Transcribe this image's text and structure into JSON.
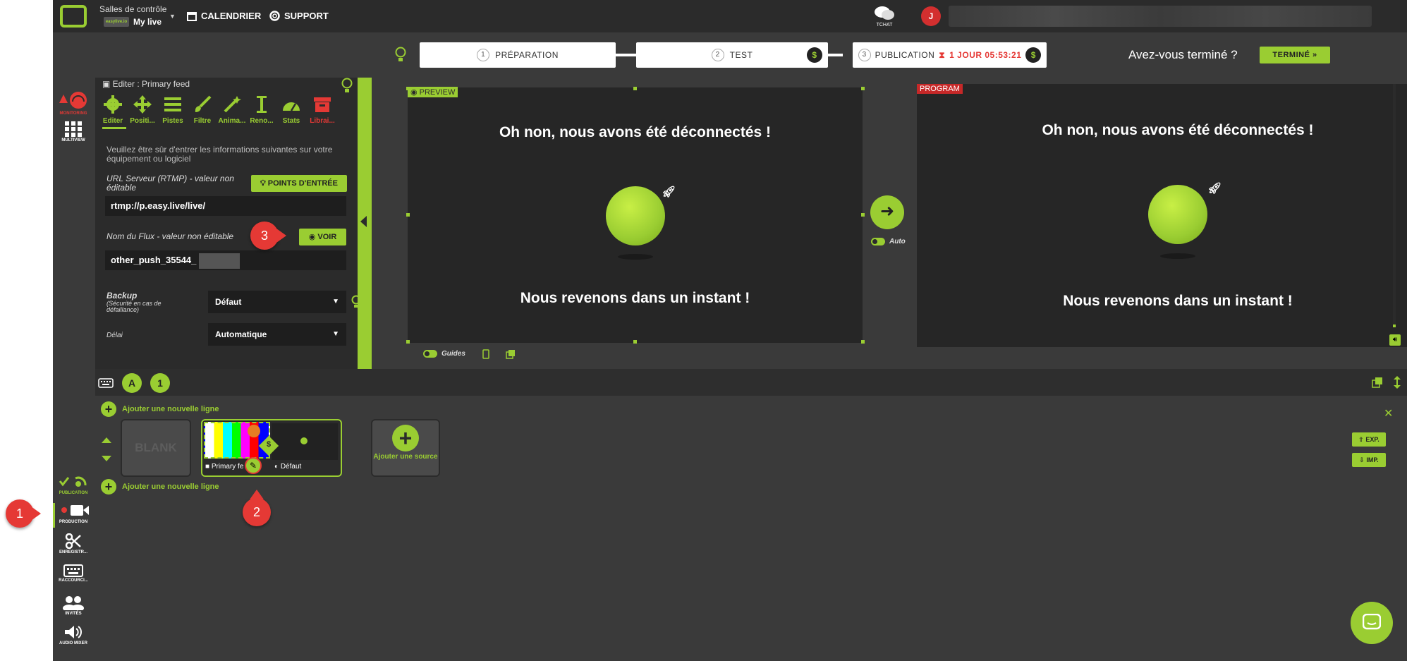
{
  "topbar": {
    "salles": "Salles de contrôle",
    "mylive": "My live",
    "mini_logo": "easylive.io",
    "calendrier": "CALENDRIER",
    "support": "SUPPORT",
    "chat": "TCHAT",
    "avatar": "J"
  },
  "steps": {
    "s1_num": "1",
    "s1_label": "PRÉPARATION",
    "s2_num": "2",
    "s2_label": "TEST",
    "s3_num": "3",
    "s3_label": "PUBLICATION",
    "countdown": "1 JOUR 05:53:21",
    "dollar": "$",
    "question": "Avez-vous terminé ?",
    "termine": "TERMINÉ"
  },
  "rail": {
    "multiview": "MULTIVIEW",
    "monitoring": "MONITORING",
    "publication": "PUBLICATION",
    "production": "PRODUCTION",
    "enregistrement": "ENREGISTR...",
    "raccourcis": "RACCOURCI...",
    "invites": "INVITÉS",
    "audio": "AUDIO MIXER"
  },
  "editor": {
    "title": "Editer : Primary feed",
    "tools": [
      "Editer",
      "Positi...",
      "Pistes",
      "Filtre",
      "Anima...",
      "Reno...",
      "Stats",
      "Librai..."
    ],
    "info": "Veuillez être sûr d'entrer les informations suivantes sur votre équipement ou logiciel",
    "url_label": "URL Serveur (RTMP) - valeur non éditable",
    "points_btn": "POINTS D'ENTRÉE",
    "url_value": "rtmp://p.easy.live/live/",
    "stream_label": "Nom du Flux - valeur non éditable",
    "voir_btn": "VOIR",
    "stream_value": "other_push_35544_",
    "backup_label": "Backup",
    "backup_sub": "(Sécurité en cas de défaillance)",
    "backup_value": "Défaut",
    "delai_label": "Délai",
    "delai_value": "Automatique"
  },
  "viewer": {
    "preview_tag": "PREVIEW",
    "program_tag": "PROGRAM",
    "message_top": "Oh non, nous avons été déconnectés !",
    "message_bottom": "Nous revenons dans un instant !",
    "auto": "Auto",
    "guides": "Guides"
  },
  "strip": {
    "btn_a": "A",
    "btn_1": "1"
  },
  "sources": {
    "add_line": "Ajouter une nouvelle ligne",
    "blank": "BLANK",
    "primary": "Primary fe",
    "default": "Défaut",
    "add_source": "Ajouter une source",
    "exp": "EXP.",
    "imp": "IMP."
  },
  "callouts": [
    "1",
    "2",
    "3"
  ],
  "colors": {
    "accent": "#9acd32",
    "danger": "#e53935",
    "dark": "#2b2b2b"
  }
}
